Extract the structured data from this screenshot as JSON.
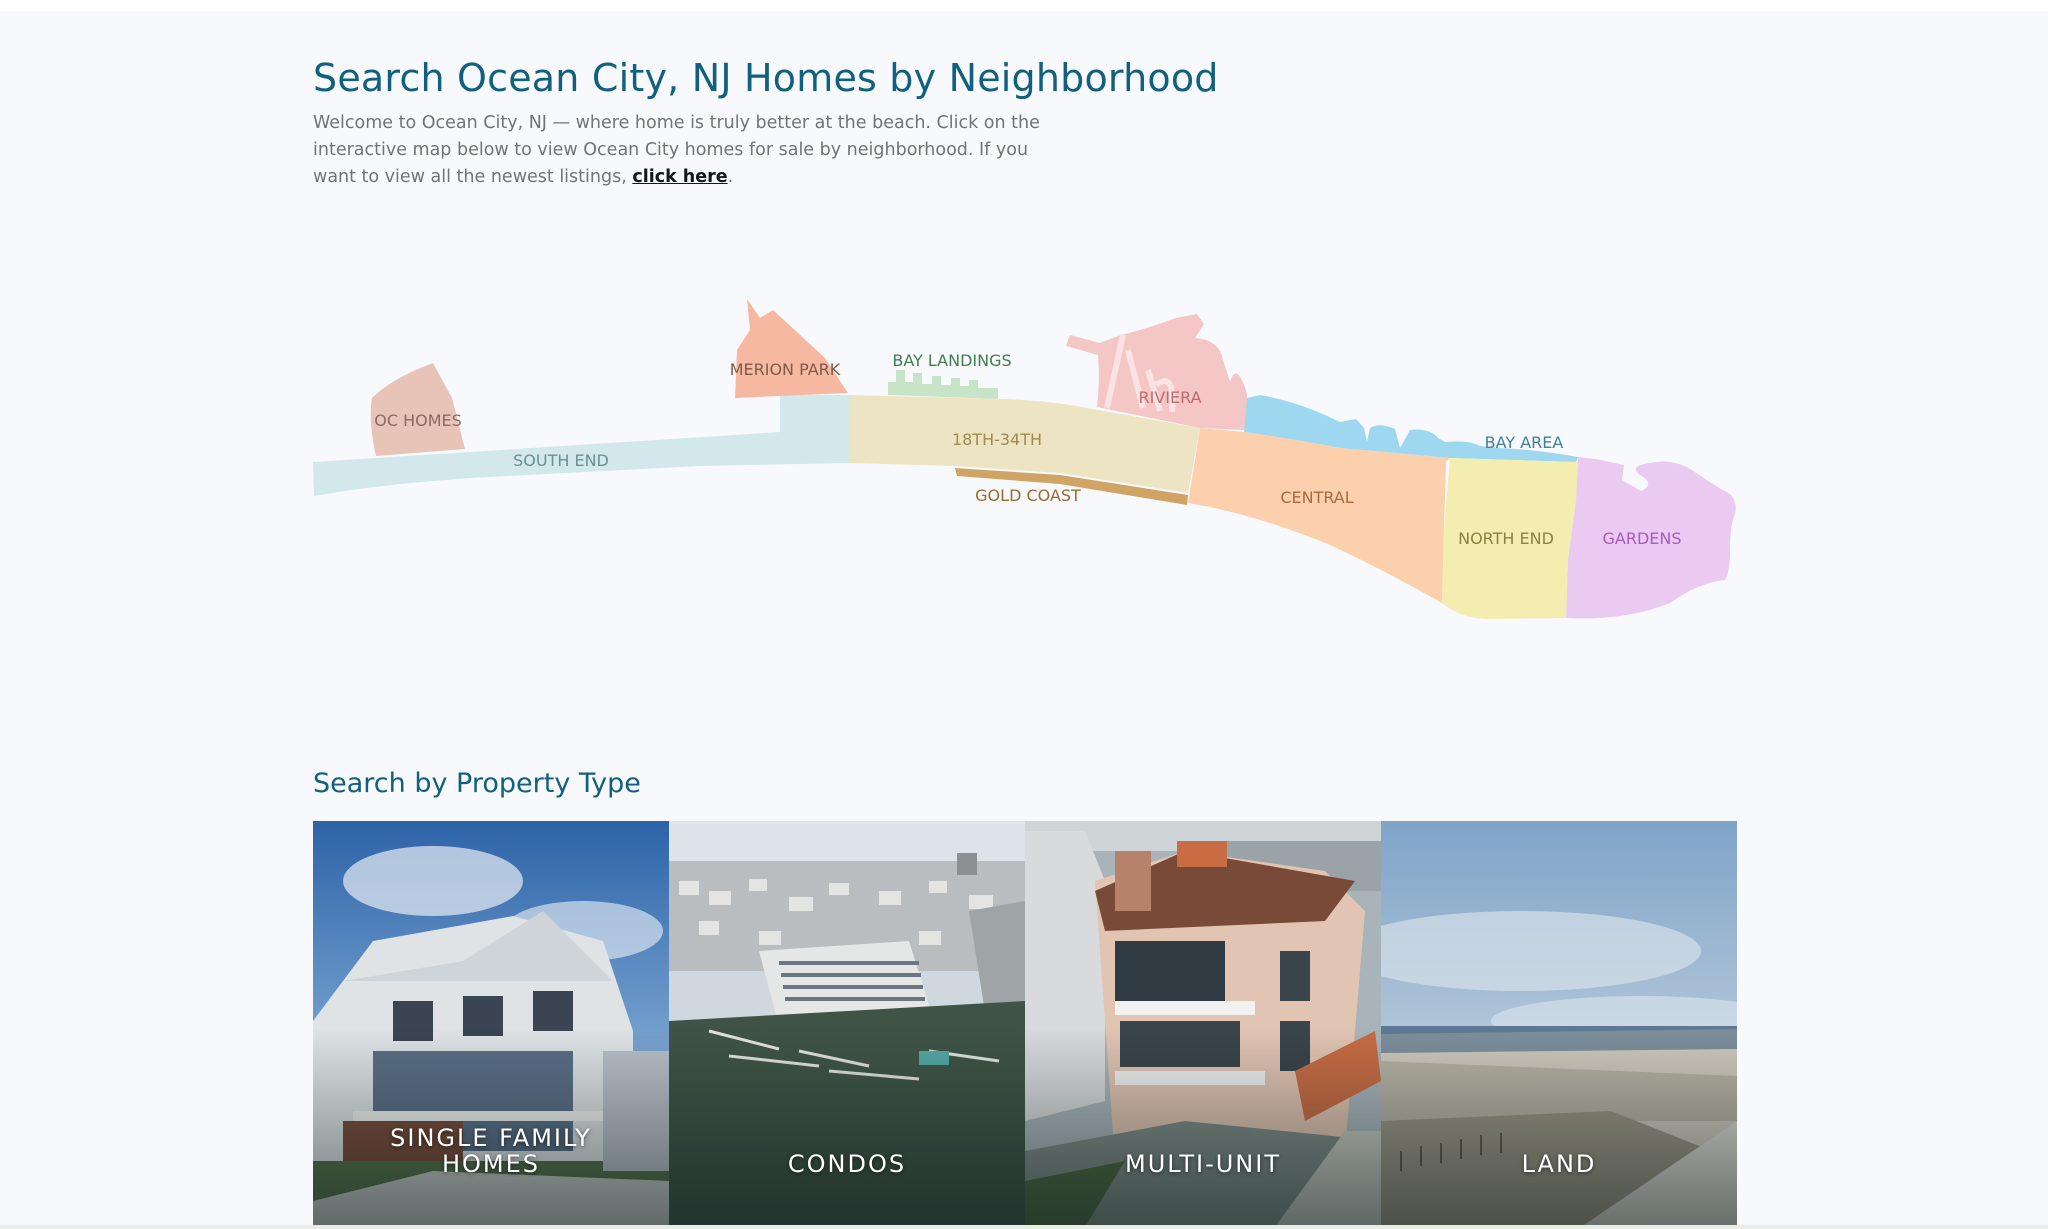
{
  "header": {
    "title": "Search Ocean City, NJ Homes by Neighborhood",
    "intro_text": "Welcome to Ocean City, NJ — where home is truly better at the beach. Click on the interactive map below to view Ocean City homes for sale by neighborhood. If you want to view all the newest listings, ",
    "intro_link": "click here",
    "intro_end": "."
  },
  "map": {
    "neighborhoods": [
      {
        "id": "south-end",
        "label": "SOUTH END",
        "color": "#d3e8ea",
        "text_color": "#6b8f95"
      },
      {
        "id": "oc-homes",
        "label": "OC HOMES",
        "color": "#e8c4b8",
        "text_color": "#8a6a62"
      },
      {
        "id": "merion-park",
        "label": "MERION PARK",
        "color": "#f6b8a0",
        "text_color": "#7f5a4a"
      },
      {
        "id": "bay-landings",
        "label": "BAY LANDINGS",
        "color": "#c7e3c8",
        "text_color": "#3f7f4a"
      },
      {
        "id": "18th-34th",
        "label": "18TH-34TH",
        "color": "#ede4c4",
        "text_color": "#a08a4e"
      },
      {
        "id": "gold-coast",
        "label": "GOLD COAST",
        "color": "#d0a464",
        "text_color": "#9a6a2e"
      },
      {
        "id": "riviera",
        "label": "RIVIERA",
        "color": "#f4c6c6",
        "text_color": "#c06a70"
      },
      {
        "id": "bay-area",
        "label": "BAY AREA",
        "color": "#9ed8f0",
        "text_color": "#3f7f9f"
      },
      {
        "id": "central",
        "label": "CENTRAL",
        "color": "#fcd0ac",
        "text_color": "#a86a3e"
      },
      {
        "id": "north-end",
        "label": "NORTH END",
        "color": "#f3eeb0",
        "text_color": "#8a8340"
      },
      {
        "id": "gardens",
        "label": "GARDENS",
        "color": "#ebcaf2",
        "text_color": "#a85ac0"
      }
    ]
  },
  "property_types": {
    "title": "Search by Property Type",
    "cards": [
      {
        "id": "single-family",
        "line1": "SINGLE FAMILY",
        "line2": "HOMES"
      },
      {
        "id": "condos",
        "line1": "",
        "line2": "CONDOS"
      },
      {
        "id": "multi-unit",
        "line1": "",
        "line2": "MULTI-UNIT"
      },
      {
        "id": "land",
        "line1": "",
        "line2": "LAND"
      }
    ]
  },
  "colors": {
    "heading": "#11607f",
    "body_text": "#6f7478",
    "background": "#f8f9fc"
  }
}
